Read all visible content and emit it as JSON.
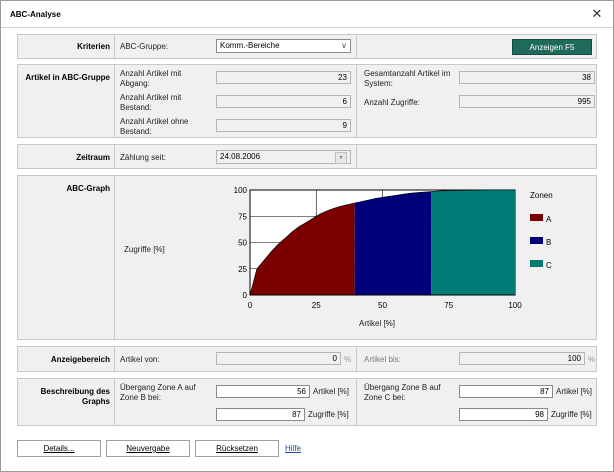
{
  "window": {
    "title": "ABC-Analyse",
    "close_glyph": "✕"
  },
  "criteria": {
    "section": "Kriterien",
    "group_label": "ABC-Gruppe:",
    "group_value": "Komm.-Bereiche",
    "show_button": "Anzeigen  F5"
  },
  "articles": {
    "section": "Artikel in ABC-Gruppe",
    "count_outflow_label": "Anzahl Artikel mit Abgang:",
    "count_outflow": "23",
    "count_stock_label": "Anzahl Artikel mit Bestand:",
    "count_stock": "6",
    "count_nostock_label": "Anzahl Artikel ohne Bestand:",
    "count_nostock": "9",
    "total_label": "Gesamtanzahl Artikel im System:",
    "total": "38",
    "access_label": "Anzahl Zugriffe:",
    "access": "995"
  },
  "period": {
    "section": "Zeitraum",
    "label": "Zählung seit:",
    "value": "24.08.2006"
  },
  "graph": {
    "section": "ABC-Graph",
    "ylabel": "Zugriffe [%]",
    "xlabel": "Artikel [%]",
    "legend_title": "Zonen",
    "colors": {
      "A": "#7b0000",
      "B": "#00007a",
      "C": "#007b76"
    }
  },
  "chart_data": {
    "type": "area",
    "xlabel": "Artikel [%]",
    "ylabel": "Zugriffe [%]",
    "xlim": [
      0,
      100
    ],
    "ylim": [
      0,
      100
    ],
    "xticks": [
      "0",
      "25",
      "50",
      "75",
      "100"
    ],
    "yticks": [
      "0",
      "25",
      "50",
      "75",
      "100"
    ],
    "grid": true,
    "legend_title": "Zonen",
    "legend_position": "right",
    "x": [
      0,
      2.6,
      5.3,
      7.9,
      10.5,
      13.2,
      15.8,
      18.4,
      21.1,
      23.7,
      26.3,
      28.9,
      31.6,
      34.2,
      36.8,
      39.5,
      42.1,
      44.7,
      47.4,
      50,
      52.6,
      55.3,
      57.9,
      60.5,
      63.2,
      65.8,
      68.4,
      71,
      73.7,
      76.3,
      78.9,
      81.6,
      84.2,
      86.8,
      89.5,
      92.1,
      94.7,
      97.4,
      100
    ],
    "y": [
      0,
      25,
      33,
      41,
      48,
      54,
      60,
      65,
      69,
      73,
      77,
      80,
      82.5,
      84.5,
      86,
      87.5,
      89,
      90.5,
      92,
      93,
      94,
      95,
      96,
      97,
      97.5,
      98,
      98.5,
      99,
      99.3,
      99.5,
      99.6,
      99.7,
      99.8,
      99.9,
      100,
      100,
      100,
      100,
      100
    ],
    "zones": [
      {
        "name": "A",
        "x_from": 0,
        "x_to": 39.5
      },
      {
        "name": "B",
        "x_from": 39.5,
        "x_to": 68.4
      },
      {
        "name": "C",
        "x_from": 68.4,
        "x_to": 100
      }
    ]
  },
  "display_range": {
    "section": "Anzeigebereich",
    "from_label": "Artikel von:",
    "from_value": "0",
    "to_label": "Artikel bis:",
    "to_value": "100",
    "unit": "%"
  },
  "description": {
    "section": "Beschreibung des Graphs",
    "ab_label": "Übergang Zone A auf Zone B bei:",
    "ab_articles": "56",
    "ab_accesses": "87",
    "bc_label": "Übergang Zone B auf Zone C bei:",
    "bc_articles": "87",
    "bc_accesses": "98",
    "unit_articles": "Artikel [%]",
    "unit_accesses": "Zugriffe [%]"
  },
  "footer": {
    "details": "Details...",
    "reset_new": "Neuvergabe",
    "reset": "Rücksetzen",
    "help": "Hilfe"
  }
}
